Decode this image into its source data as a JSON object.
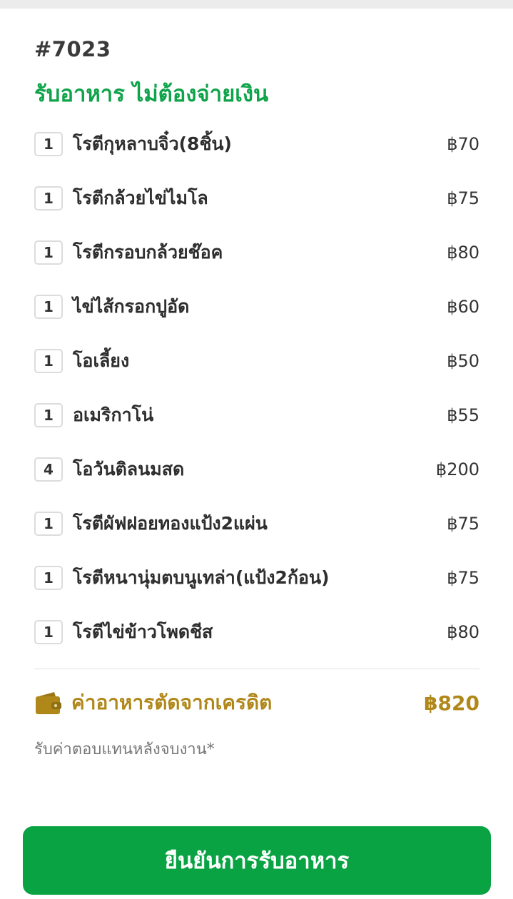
{
  "order": {
    "number": "#7023",
    "status": "รับอาหาร ไม่ต้องจ่ายเงิน"
  },
  "items": [
    {
      "qty": "1",
      "name": "โรตีกุหลาบจิ๋ว(8ชิ้น)",
      "price": "฿70"
    },
    {
      "qty": "1",
      "name": "โรตีกล้วยไข่ไมโล",
      "price": "฿75"
    },
    {
      "qty": "1",
      "name": "โรตีกรอบกล้วยช๊อค",
      "price": "฿80"
    },
    {
      "qty": "1",
      "name": "ไข่ไส้กรอกปูอัด",
      "price": "฿60"
    },
    {
      "qty": "1",
      "name": "โอเลี้ยง",
      "price": "฿50"
    },
    {
      "qty": "1",
      "name": "อเมริกาโน่",
      "price": "฿55"
    },
    {
      "qty": "4",
      "name": "โอวันติลนมสด",
      "price": "฿200"
    },
    {
      "qty": "1",
      "name": "โรตีผัฟฝอยทองแป้ง2แผ่น",
      "price": "฿75"
    },
    {
      "qty": "1",
      "name": "โรตีหนานุ่มตบนูเทล่า(แป้ง2ก้อน)",
      "price": "฿75"
    },
    {
      "qty": "1",
      "name": "โรตีไข่ข้าวโพดชีส",
      "price": "฿80"
    }
  ],
  "summary": {
    "icon": "wallet-icon",
    "label": "ค่าอาหารตัดจากเครดิต",
    "amount": "฿820",
    "note": "รับค่าตอบแทนหลังจบงาน*"
  },
  "action": {
    "confirm_label": "ยืนยันการรับอาหาร"
  },
  "colors": {
    "status_green": "#0fa34a",
    "credit_gold": "#b0881a",
    "button_green": "#0aa344"
  }
}
